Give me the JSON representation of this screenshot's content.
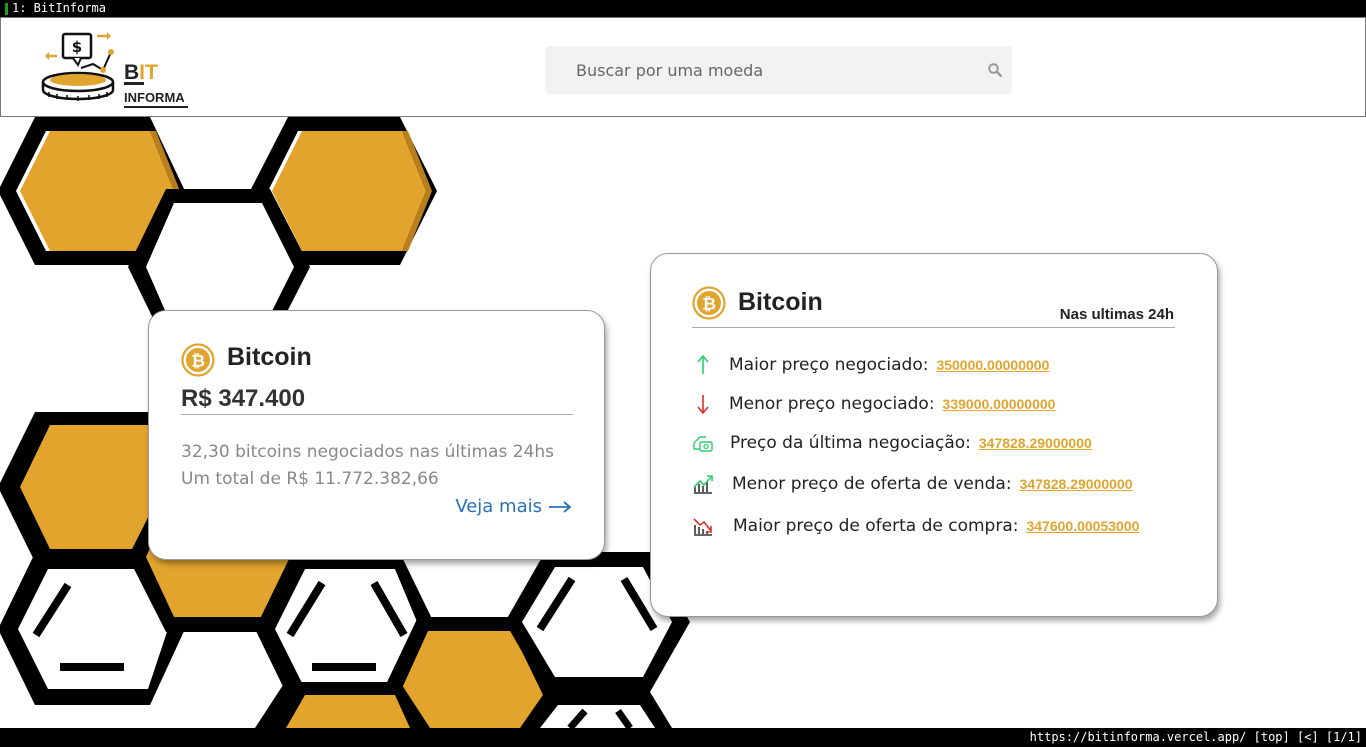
{
  "browser": {
    "tab_label": "1: BitInforma",
    "status_text": "https://bitinforma.vercel.app/ [top] [<] [1/1]"
  },
  "header": {
    "logo_bit": "BIT",
    "logo_bit_b": "B",
    "logo_bit_it": "IT",
    "logo_informa": "INFORMA",
    "search_placeholder": "Buscar por uma moeda"
  },
  "summary_card": {
    "coin_name": "Bitcoin",
    "price": "R$ 347.400",
    "traded_text": "32,30 bitcoins negociados nas últimas 24hs",
    "total_text": "Um total de R$ 11.772.382,66",
    "more_label": "Veja mais"
  },
  "detail_card": {
    "coin_name": "Bitcoin",
    "subtitle": "Nas ultimas 24h",
    "rows": [
      {
        "label": "Maior preço negociado:",
        "value": "350000.00000000",
        "icon": "arrow-up-icon"
      },
      {
        "label": "Menor preço negociado:",
        "value": "339000.00000000",
        "icon": "arrow-down-icon"
      },
      {
        "label": "Preço da última negociação:",
        "value": "347828.29000000",
        "icon": "money-hand-icon"
      },
      {
        "label": "Menor preço de oferta de venda:",
        "value": "347828.29000000",
        "icon": "chart-up-icon"
      },
      {
        "label": "Maior preço de oferta de compra:",
        "value": "347600.00053000",
        "icon": "chart-down-icon"
      }
    ]
  },
  "colors": {
    "brand_gold": "#e0a52f",
    "link_blue": "#2a72b5",
    "up_green": "#2ecc71",
    "down_red": "#d63031"
  }
}
